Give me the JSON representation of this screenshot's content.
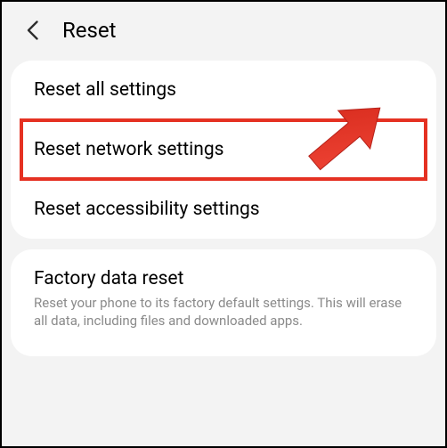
{
  "header": {
    "title": "Reset"
  },
  "items": [
    {
      "title": "Reset all settings"
    },
    {
      "title": "Reset network settings"
    },
    {
      "title": "Reset accessibility settings"
    }
  ],
  "factory": {
    "title": "Factory data reset",
    "subtitle": "Reset your phone to its factory default settings. This will erase all data, including files and downloaded apps."
  },
  "annotation": {
    "highlight_color": "#e53122",
    "arrow_color": "#e53122"
  }
}
